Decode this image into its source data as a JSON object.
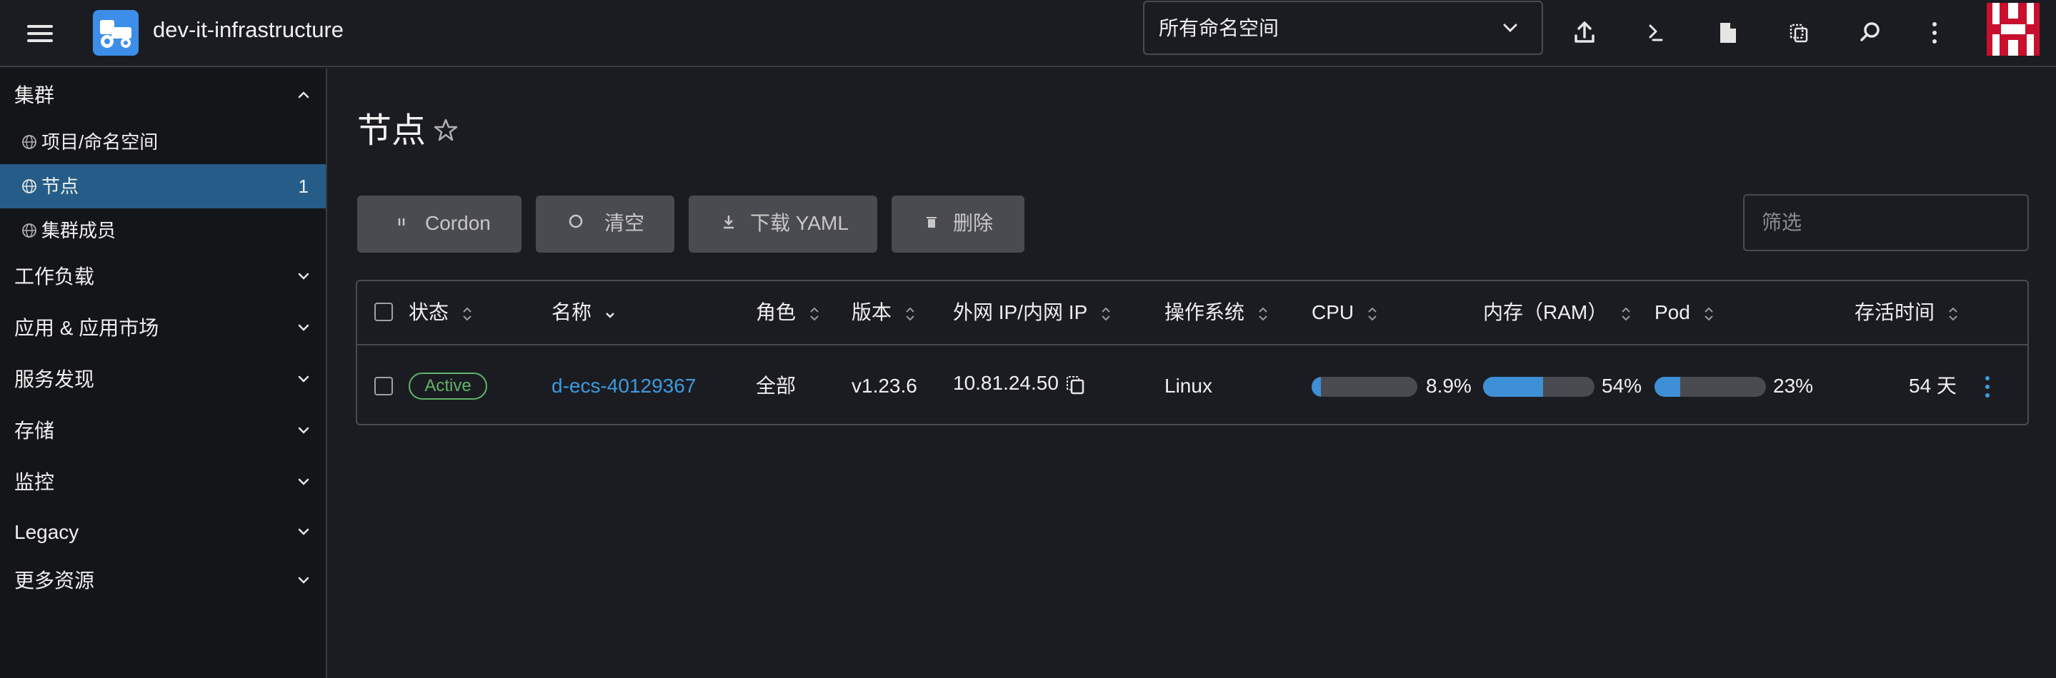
{
  "header": {
    "cluster_name": "dev-it-infrastructure",
    "namespace_select": "所有命名空间",
    "icons": [
      "upload-icon",
      "terminal-icon",
      "file-icon",
      "copy-icon",
      "search-icon",
      "more-vertical-icon"
    ],
    "avatar_color": "#c8102e"
  },
  "sidebar": {
    "cluster_group": "集群",
    "cluster_items": [
      {
        "label": "项目/命名空间",
        "count": ""
      },
      {
        "label": "节点",
        "count": "1"
      },
      {
        "label": "集群成员",
        "count": ""
      }
    ],
    "groups": [
      "工作负载",
      "应用 & 应用市场",
      "服务发现",
      "存储",
      "监控",
      "Legacy",
      "更多资源"
    ]
  },
  "main": {
    "title": "节点",
    "buttons": {
      "cordon": "Cordon",
      "drain": "清空",
      "download_yaml": "下载 YAML",
      "delete": "删除"
    },
    "filter_placeholder": "筛选",
    "table": {
      "headers": {
        "state": "状态",
        "name": "名称",
        "role": "角色",
        "version": "版本",
        "ip": "外网 IP/内网 IP",
        "os": "操作系统",
        "cpu": "CPU",
        "ram": "内存（RAM）",
        "pod": "Pod",
        "age": "存活时间"
      },
      "rows": [
        {
          "state": "Active",
          "name": "d-ecs-40129367",
          "role": "全部",
          "version": "v1.23.6",
          "ip": "10.81.24.50",
          "os": "Linux",
          "cpu": "8.9%",
          "cpu_fraction": 0.089,
          "ram": "54%",
          "ram_fraction": 0.54,
          "pod": "23%",
          "pod_fraction": 0.23,
          "age": "54 天"
        }
      ]
    }
  },
  "colors": {
    "accent": "#3d8fd6",
    "active_nav": "#255d88",
    "status_active": "#5fb46a",
    "link": "#3d9be0"
  }
}
